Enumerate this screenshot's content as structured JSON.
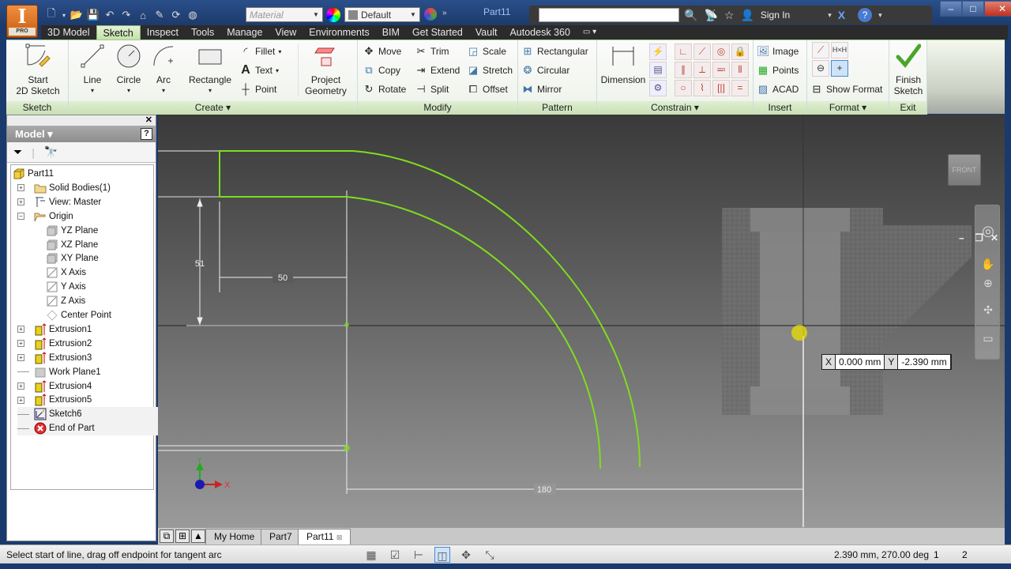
{
  "app": {
    "logo_letter": "I",
    "edition": "PRO",
    "document_title": "Part11",
    "material_placeholder": "Material",
    "appearance_value": "Default",
    "sign_in": "Sign In"
  },
  "menu_tabs": [
    "3D Model",
    "Sketch",
    "Inspect",
    "Tools",
    "Manage",
    "View",
    "Environments",
    "BIM",
    "Get Started",
    "Vault",
    "Autodesk 360"
  ],
  "active_tab": "Sketch",
  "ribbon": {
    "sketch_panel": {
      "title": "Sketch",
      "start_2d_sketch": "Start\n2D Sketch",
      "start_line1": "Start",
      "start_line2": "2D Sketch"
    },
    "create_panel": {
      "title": "Create",
      "line": "Line",
      "circle": "Circle",
      "arc": "Arc",
      "rectangle": "Rectangle",
      "fillet": "Fillet",
      "text": "Text",
      "point": "Point",
      "project_line1": "Project",
      "project_line2": "Geometry"
    },
    "modify_panel": {
      "title": "Modify",
      "move": "Move",
      "copy": "Copy",
      "rotate": "Rotate",
      "trim": "Trim",
      "extend": "Extend",
      "split": "Split",
      "scale": "Scale",
      "stretch": "Stretch",
      "offset": "Offset"
    },
    "pattern_panel": {
      "title": "Pattern",
      "rectangular": "Rectangular",
      "circular": "Circular",
      "mirror": "Mirror"
    },
    "constrain_panel": {
      "title": "Constrain",
      "dimension": "Dimension"
    },
    "insert_panel": {
      "title": "Insert",
      "image": "Image",
      "points": "Points",
      "acad": "ACAD"
    },
    "format_panel": {
      "title": "Format",
      "show_format": "Show Format"
    },
    "exit_panel": {
      "title": "Exit",
      "finish_line1": "Finish",
      "finish_line2": "Sketch"
    }
  },
  "browser": {
    "title": "Model",
    "help": "?",
    "tree": [
      {
        "label": "Part11",
        "icon": "part-icon",
        "level": 0,
        "expander": ""
      },
      {
        "label": "Solid Bodies(1)",
        "icon": "folder-icon",
        "level": 1,
        "expander": "+"
      },
      {
        "label": "View: Master",
        "icon": "view-icon",
        "level": 1,
        "expander": "+"
      },
      {
        "label": "Origin",
        "icon": "folder-open-icon",
        "level": 1,
        "expander": "-"
      },
      {
        "label": "YZ Plane",
        "icon": "plane-icon",
        "level": 2,
        "expander": ""
      },
      {
        "label": "XZ Plane",
        "icon": "plane-icon",
        "level": 2,
        "expander": ""
      },
      {
        "label": "XY Plane",
        "icon": "plane-icon",
        "level": 2,
        "expander": ""
      },
      {
        "label": "X Axis",
        "icon": "axis-icon",
        "level": 2,
        "expander": ""
      },
      {
        "label": "Y Axis",
        "icon": "axis-icon",
        "level": 2,
        "expander": ""
      },
      {
        "label": "Z Axis",
        "icon": "axis-icon",
        "level": 2,
        "expander": ""
      },
      {
        "label": "Center Point",
        "icon": "point-icon",
        "level": 2,
        "expander": ""
      },
      {
        "label": "Extrusion1",
        "icon": "extrusion-icon",
        "level": 1,
        "expander": "+"
      },
      {
        "label": "Extrusion2",
        "icon": "extrusion-icon",
        "level": 1,
        "expander": "+"
      },
      {
        "label": "Extrusion3",
        "icon": "extrusion-icon",
        "level": 1,
        "expander": "+"
      },
      {
        "label": "Work Plane1",
        "icon": "workplane-icon",
        "level": 1,
        "expander": ""
      },
      {
        "label": "Extrusion4",
        "icon": "extrusion-icon",
        "level": 1,
        "expander": "+"
      },
      {
        "label": "Extrusion5",
        "icon": "extrusion-icon",
        "level": 1,
        "expander": "+"
      },
      {
        "label": "Sketch6",
        "icon": "sketch-icon",
        "level": 1,
        "expander": ""
      },
      {
        "label": "End of Part",
        "icon": "end-of-part-icon",
        "level": 1,
        "expander": ""
      }
    ]
  },
  "viewport": {
    "viewcube_label": "FRONT",
    "dimensions": {
      "vertical": "51",
      "horizontal_short": "50",
      "horizontal_long": "180"
    },
    "axis_x": "X",
    "axis_y": "Y",
    "coord_input": {
      "x_label": "X",
      "x_value": "0.000 mm",
      "y_label": "Y",
      "y_value": "-2.390 mm"
    },
    "sketch_color": "#7fdc1e"
  },
  "doc_tabs": [
    "My Home",
    "Part7",
    "Part11"
  ],
  "active_doc": "Part11",
  "status": {
    "message": "Select start of line, drag off endpoint for tangent arc",
    "readout": "2.390 mm, 270.00 deg",
    "field1": "1",
    "field2": "2"
  }
}
